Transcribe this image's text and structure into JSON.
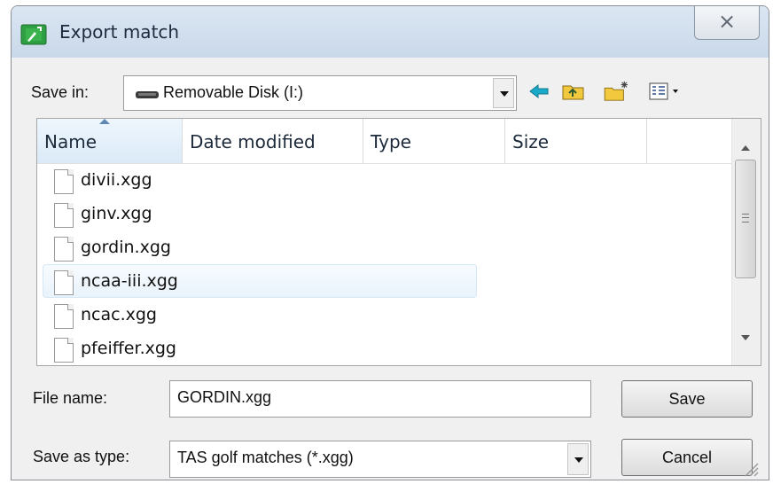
{
  "window": {
    "title": "Export match",
    "close_glyph": "⨯"
  },
  "toolbar": {
    "save_in_label": "Save in:",
    "save_in_value": "Removable Disk (I:)",
    "icons": [
      "back-arrow-icon",
      "up-folder-icon",
      "new-folder-icon",
      "view-menu-icon"
    ]
  },
  "columns": [
    {
      "label": "Name"
    },
    {
      "label": "Date modified"
    },
    {
      "label": "Type"
    },
    {
      "label": "Size"
    }
  ],
  "files": [
    {
      "name": "divii.xgg"
    },
    {
      "name": "ginv.xgg"
    },
    {
      "name": "gordin.xgg"
    },
    {
      "name": "ncaa-iii.xgg"
    },
    {
      "name": "ncac.xgg"
    },
    {
      "name": "pfeiffer.xgg"
    }
  ],
  "hovered_file": "ncaa-iii.xgg",
  "form": {
    "file_name_label": "File name:",
    "file_name_value": "GORDIN.xgg",
    "save_as_type_label": "Save as type:",
    "save_as_type_value": "TAS golf matches (*.xgg)"
  },
  "buttons": {
    "save": "Save",
    "cancel": "Cancel"
  },
  "colors": {
    "title_bar": "#c9d8ea",
    "accent": "#5f87b4",
    "hover": "#e9f3fb"
  }
}
